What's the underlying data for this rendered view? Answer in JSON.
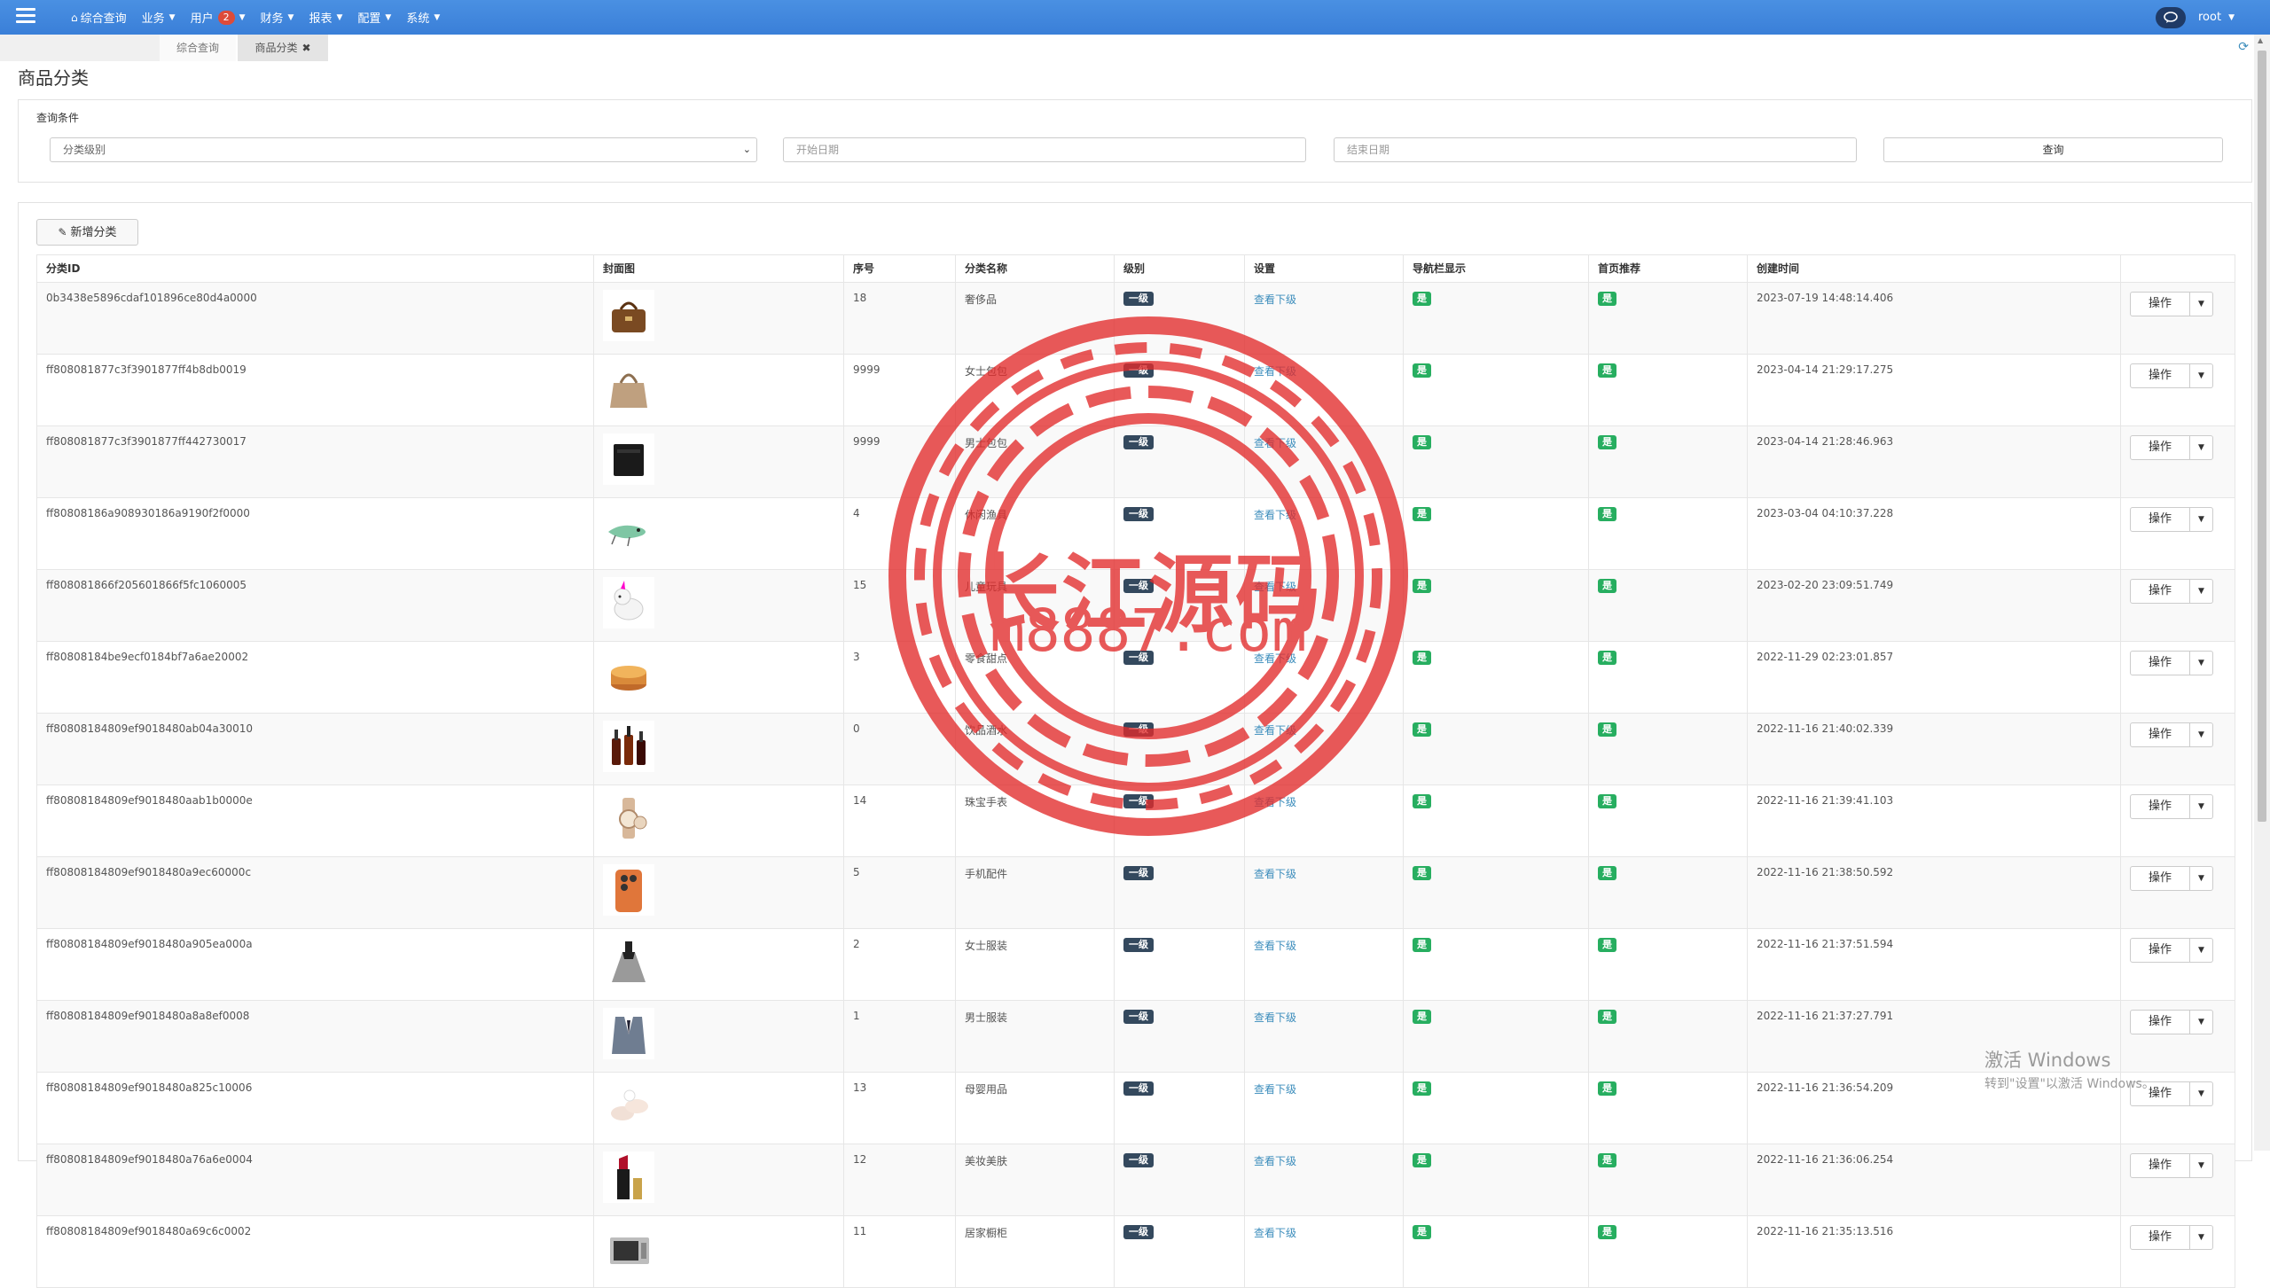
{
  "navbar": {
    "menu": [
      {
        "label": "综合查询",
        "has_caret": false,
        "icon": "home-icon"
      },
      {
        "label": "业务",
        "has_caret": true
      },
      {
        "label": "用户",
        "has_caret": true,
        "badge": "2"
      },
      {
        "label": "财务",
        "has_caret": true
      },
      {
        "label": "报表",
        "has_caret": true
      },
      {
        "label": "配置",
        "has_caret": true
      },
      {
        "label": "系统",
        "has_caret": true
      }
    ],
    "user": "root",
    "colors": {
      "bar": "#3a7fd8",
      "badge": "#dd4b39"
    }
  },
  "tabs": {
    "home_label": "综合查询",
    "active_label": "商品分类"
  },
  "page": {
    "title": "商品分类"
  },
  "query": {
    "section_label": "查询条件",
    "level_select_value": "分类级别",
    "start_placeholder": "开始日期",
    "end_placeholder": "结束日期",
    "search_label": "查询"
  },
  "toolbar": {
    "add_label": "新增分类"
  },
  "table": {
    "headers": [
      "分类ID",
      "封面图",
      "序号",
      "分类名称",
      "级别",
      "设置",
      "导航栏显示",
      "首页推荐",
      "创建时间",
      ""
    ],
    "rows": [
      {
        "id": "0b3438e5896cdaf101896ce80d4a0000",
        "thumb": "handbag-brown",
        "sort": "18",
        "name": "奢侈品",
        "level": "一级",
        "setting": "查看下级",
        "nav": "是",
        "home": "是",
        "created": "2023-07-19 14:48:14.406",
        "op": "操作"
      },
      {
        "id": "ff808081877c3f3901877ff4b8db0019",
        "thumb": "handbag-tan",
        "sort": "9999",
        "name": "女士包包",
        "level": "一级",
        "setting": "查看下级",
        "nav": "是",
        "home": "是",
        "created": "2023-04-14 21:29:17.275",
        "op": "操作"
      },
      {
        "id": "ff808081877c3f3901877ff442730017",
        "thumb": "wallet-black",
        "sort": "9999",
        "name": "男士包包",
        "level": "一级",
        "setting": "查看下级",
        "nav": "是",
        "home": "是",
        "created": "2023-04-14 21:28:46.963",
        "op": "操作"
      },
      {
        "id": "ff80808186a908930186a9190f2f0000",
        "thumb": "fishing-lure",
        "sort": "4",
        "name": "休闲渔具",
        "level": "一级",
        "setting": "查看下级",
        "nav": "是",
        "home": "是",
        "created": "2023-03-04 04:10:37.228",
        "op": "操作"
      },
      {
        "id": "ff808081866f205601866f5fc1060005",
        "thumb": "plush-unicorn",
        "sort": "15",
        "name": "儿童玩具",
        "level": "一级",
        "setting": "查看下级",
        "nav": "是",
        "home": "是",
        "created": "2023-02-20 23:09:51.749",
        "op": "操作"
      },
      {
        "id": "ff80808184be9ecf0184bf7a6ae20002",
        "thumb": "cake",
        "sort": "3",
        "name": "零食甜点",
        "level": "一级",
        "setting": "查看下级",
        "nav": "是",
        "home": "是",
        "created": "2022-11-29 02:23:01.857",
        "op": "操作"
      },
      {
        "id": "ff80808184809ef9018480ab04a30010",
        "thumb": "wine-bottles",
        "sort": "0",
        "name": "饮品酒水",
        "level": "一级",
        "setting": "查看下级",
        "nav": "是",
        "home": "是",
        "created": "2022-11-16 21:40:02.339",
        "op": "操作"
      },
      {
        "id": "ff80808184809ef9018480aab1b0000e",
        "thumb": "watch",
        "sort": "14",
        "name": "珠宝手表",
        "level": "一级",
        "setting": "查看下级",
        "nav": "是",
        "home": "是",
        "created": "2022-11-16 21:39:41.103",
        "op": "操作"
      },
      {
        "id": "ff80808184809ef9018480a9ec60000c",
        "thumb": "phone-orange",
        "sort": "5",
        "name": "手机配件",
        "level": "一级",
        "setting": "查看下级",
        "nav": "是",
        "home": "是",
        "created": "2022-11-16 21:38:50.592",
        "op": "操作"
      },
      {
        "id": "ff80808184809ef9018480a905ea000a",
        "thumb": "dress",
        "sort": "2",
        "name": "女士服装",
        "level": "一级",
        "setting": "查看下级",
        "nav": "是",
        "home": "是",
        "created": "2022-11-16 21:37:51.594",
        "op": "操作"
      },
      {
        "id": "ff80808184809ef9018480a8a8ef0008",
        "thumb": "suit",
        "sort": "1",
        "name": "男士服装",
        "level": "一级",
        "setting": "查看下级",
        "nav": "是",
        "home": "是",
        "created": "2022-11-16 21:37:27.791",
        "op": "操作"
      },
      {
        "id": "ff80808184809ef9018480a825c10006",
        "thumb": "baby-shoes",
        "sort": "13",
        "name": "母婴用品",
        "level": "一级",
        "setting": "查看下级",
        "nav": "是",
        "home": "是",
        "created": "2022-11-16 21:36:54.209",
        "op": "操作"
      },
      {
        "id": "ff80808184809ef9018480a76a6e0004",
        "thumb": "lipstick",
        "sort": "12",
        "name": "美妆美肤",
        "level": "一级",
        "setting": "查看下级",
        "nav": "是",
        "home": "是",
        "created": "2022-11-16 21:36:06.254",
        "op": "操作"
      },
      {
        "id": "ff80808184809ef9018480a69c6c0002",
        "thumb": "microwave",
        "sort": "11",
        "name": "居家橱柜",
        "level": "一级",
        "setting": "查看下级",
        "nav": "是",
        "home": "是",
        "created": "2022-11-16 21:35:13.516",
        "op": "操作"
      }
    ]
  },
  "watermark": {
    "line1": "长江源码",
    "line2": "m8887.com",
    "color": "#e22b2b"
  },
  "windows_activation": {
    "line1": "激活 Windows",
    "line2": "转到\"设置\"以激活 Windows。"
  }
}
